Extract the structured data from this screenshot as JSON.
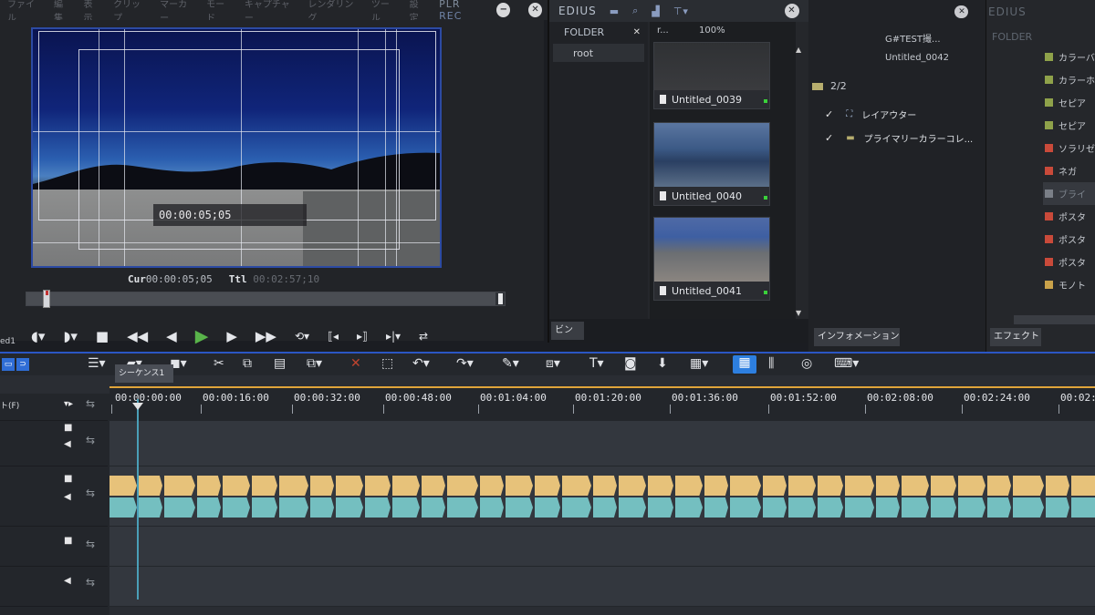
{
  "menubar": {
    "items": [
      "ファイル",
      "編集",
      "表示",
      "クリップ",
      "マーカー",
      "モード",
      "キャプチャー",
      "レンダリング",
      "ツール",
      "設定",
      "ヘルプ"
    ],
    "plr": "PLR",
    "rec": "REC"
  },
  "player": {
    "overlay_timecode": "00:00:05;05",
    "cur_label": "Cur",
    "cur_timecode": "00:00:05;05",
    "ttl_label": "Ttl",
    "ttl_timecode": "00:02:57;10",
    "buttons": [
      "mark-in",
      "mark-out",
      "stop",
      "rewind",
      "prev-frame",
      "play",
      "next-frame",
      "fast-forward",
      "loop",
      "set-in",
      "set-out",
      "insert",
      "overwrite"
    ]
  },
  "bin": {
    "brand": "EDIUS",
    "folder_label": "FOLDER",
    "root_label": "root",
    "path_label": "r...",
    "zoom": "100%",
    "clips": [
      {
        "name": "Untitled_0039"
      },
      {
        "name": "Untitled_0040"
      },
      {
        "name": "Untitled_0041"
      }
    ],
    "tab_label": "ビン"
  },
  "info": {
    "clip_title": "G#TEST撮...",
    "clip_id": "Untitled_0042",
    "counter": "2/2",
    "effects": [
      "レイアウター",
      "プライマリーカラーコレ..."
    ],
    "tab_label": "インフォメーション"
  },
  "effects_panel": {
    "brand": "EDIUS",
    "folder_label": "FOLDER",
    "items": [
      {
        "label": "カラーバ",
        "color": "#8fa24a"
      },
      {
        "label": "カラーホ",
        "color": "#8fa24a"
      },
      {
        "label": "セピア",
        "color": "#8fa24a"
      },
      {
        "label": "セピア",
        "color": "#8fa24a"
      },
      {
        "label": "ソラリゼ",
        "color": "#c94a3a"
      },
      {
        "label": "ネガ",
        "color": "#c94a3a"
      },
      {
        "label": "ブライ",
        "color": "#7a7f87"
      },
      {
        "label": "ポスタ",
        "color": "#c94a3a"
      },
      {
        "label": "ポスタ",
        "color": "#c94a3a"
      },
      {
        "label": "ポスタ",
        "color": "#c94a3a"
      },
      {
        "label": "モノト",
        "color": "#c9a24a"
      }
    ],
    "tab_label": "エフェクト"
  },
  "timeline": {
    "sequence_tab": "シーケンス1",
    "track_label": "ト(F)",
    "ruler_labels": [
      "00:00:00:00",
      "00:00:16:00",
      "00:00:32:00",
      "00:00:48:00",
      "00:01:04:00",
      "00:01:20:00",
      "00:01:36:00",
      "00:01:52:00",
      "00:02:08:00",
      "00:02:24:00",
      "00:02:"
    ],
    "side_label": "ed1"
  },
  "colors": {
    "accent_blue": "#2b56c4",
    "play_green": "#59b44a",
    "clip_video": "#e7c27a",
    "clip_audio": "#74bfc0",
    "ruler_line": "#e0a43a"
  }
}
